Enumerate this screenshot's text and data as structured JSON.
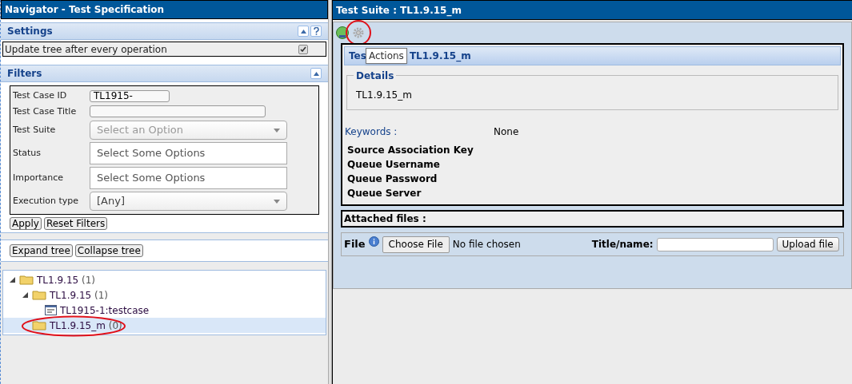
{
  "navigator": {
    "title": "Navigator - Test Specification",
    "settings": {
      "title": "Settings",
      "options": [
        {
          "label": "Update tree after every operation",
          "checked": true
        }
      ]
    },
    "filters": {
      "title": "Filters",
      "fields": [
        {
          "kind": "text",
          "label": "Test Case ID",
          "value": "TL1915-"
        },
        {
          "kind": "text",
          "label": "Test Case Title"
        },
        {
          "kind": "select",
          "label": "Test Suite",
          "placeholder": "Select an Option"
        },
        {
          "kind": "multi",
          "label": "Status",
          "placeholder": "Select Some Options"
        },
        {
          "kind": "multi",
          "label": "Importance",
          "placeholder": "Select Some Options"
        },
        {
          "kind": "select",
          "label": "Execution type",
          "value": "[Any]"
        }
      ],
      "buttons": [
        "Apply",
        "Reset Filters"
      ]
    },
    "tree_buttons": [
      "Expand tree",
      "Collapse tree"
    ],
    "tree": [
      {
        "kind": "folder",
        "label": "TL1.9.15",
        "count": "(1)",
        "expanded": true,
        "selected": false,
        "circled": false,
        "children": [
          {
            "kind": "folder",
            "label": "TL1.9.15",
            "count": "(1)",
            "expanded": true,
            "selected": false,
            "circled": false,
            "children": [
              {
                "kind": "testcase",
                "label": "TL1915-1:testcase",
                "selected": false,
                "circled": false
              }
            ]
          },
          {
            "kind": "folder",
            "label": "TL1.9.15_m",
            "count": "(0)",
            "expanded": false,
            "selected": true,
            "circled": true
          }
        ]
      }
    ]
  },
  "detail": {
    "title": "Test Suite : TL1.9.15_m",
    "toolbar": [
      {
        "kind": "globe",
        "circled": false
      },
      {
        "kind": "gear",
        "circled": true
      }
    ],
    "tooltip": "Actions",
    "header_visible": [
      "Tes",
      "TL1.9.15_m"
    ],
    "details": {
      "legend": "Details",
      "text": "TL1.9.15_m"
    },
    "keywords": {
      "label": "Keywords :",
      "value": "None"
    },
    "fields": [
      "Source Association Key",
      "Queue Username",
      "Queue Password",
      "Queue Server"
    ],
    "attachments": {
      "label": "Attached files :"
    },
    "upload": {
      "file_label": "File",
      "choose": "Choose File",
      "status": "No file chosen",
      "title_label": "Title/name:",
      "button": "Upload file"
    }
  }
}
